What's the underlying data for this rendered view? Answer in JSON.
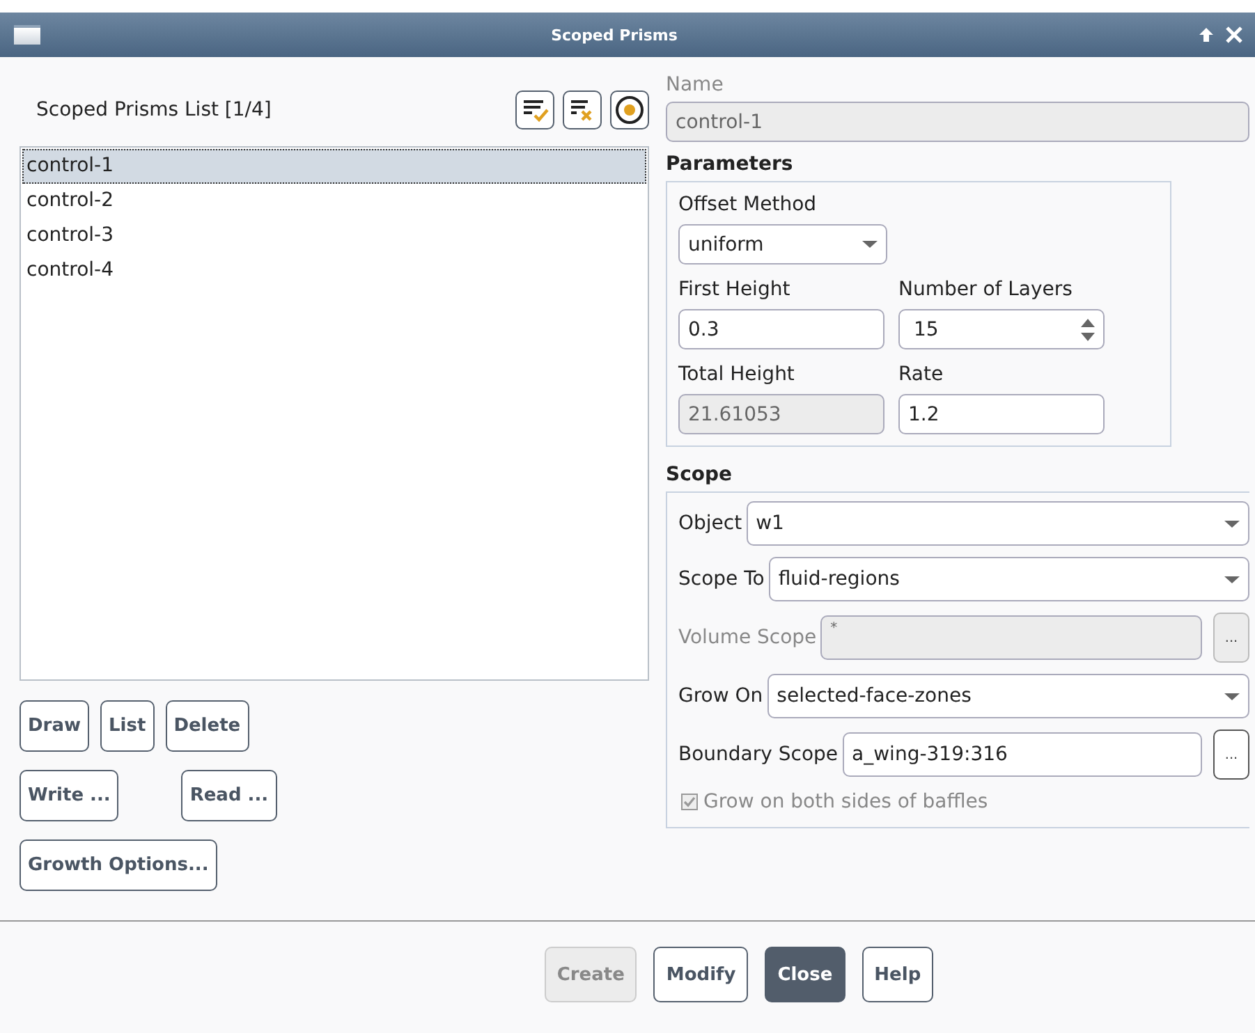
{
  "window": {
    "title": "Scoped Prisms"
  },
  "prisms_list": {
    "label": "Scoped Prisms List [1/4]",
    "items": [
      {
        "label": "control-1",
        "selected": true
      },
      {
        "label": "control-2",
        "selected": false
      },
      {
        "label": "control-3",
        "selected": false
      },
      {
        "label": "control-4",
        "selected": false
      }
    ]
  },
  "list_button_rows": [
    {
      "buttons": [
        "Draw",
        "List",
        "Delete"
      ]
    },
    {
      "buttons": [
        "Write ...",
        "Read ..."
      ]
    },
    {
      "buttons": [
        "Growth Options..."
      ]
    }
  ],
  "name": {
    "label": "Name",
    "value": "control-1",
    "disabled": true
  },
  "parameters": {
    "title": "Parameters",
    "offset_method": {
      "label": "Offset Method",
      "value": "uniform"
    },
    "fields": [
      {
        "label": "First Height",
        "value": "0.3",
        "kind": "text",
        "disabled": false
      },
      {
        "label": "Number of Layers",
        "value": "15",
        "kind": "spin",
        "disabled": false
      },
      {
        "label": "Total Height",
        "value": "21.61053",
        "kind": "text",
        "disabled": true
      },
      {
        "label": "Rate",
        "value": "1.2",
        "kind": "text",
        "disabled": false
      }
    ]
  },
  "scope": {
    "title": "Scope",
    "fields": [
      {
        "label": "Object",
        "value": "w1",
        "kind": "dropdown",
        "disabled": false
      },
      {
        "label": "Scope To",
        "value": "fluid-regions",
        "kind": "dropdown",
        "disabled": false
      },
      {
        "label": "Volume Scope",
        "value": "*",
        "kind": "browse",
        "disabled": true,
        "button": "..."
      },
      {
        "label": "Grow On",
        "value": "selected-face-zones",
        "kind": "dropdown",
        "disabled": false
      },
      {
        "label": "Boundary Scope",
        "value": "a_wing-319:316",
        "kind": "browse",
        "disabled": false,
        "button": "..."
      }
    ],
    "checkbox": {
      "label": "Grow on both sides of baffles",
      "checked": true,
      "disabled": true
    }
  },
  "buttons": [
    {
      "label": "Create",
      "disabled": true,
      "default": false
    },
    {
      "label": "Modify",
      "disabled": false,
      "default": false
    },
    {
      "label": "Close",
      "disabled": false,
      "default": true
    },
    {
      "label": "Help",
      "disabled": false,
      "default": false
    }
  ]
}
